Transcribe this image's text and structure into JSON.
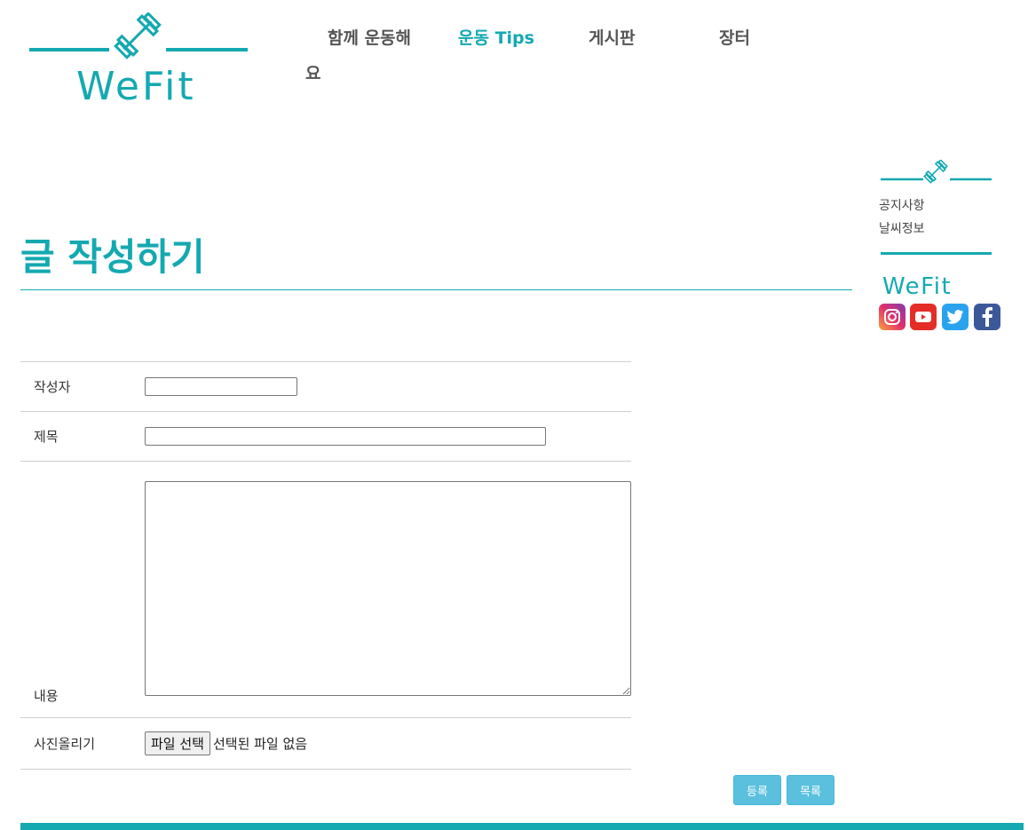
{
  "header": {
    "logo_text": "WeFit",
    "nav": [
      {
        "label": "함께 운동해",
        "wrap": "요",
        "active": false
      },
      {
        "label": "운동 Tips",
        "active": true
      },
      {
        "label": "게시판",
        "active": false
      },
      {
        "label": "장터",
        "active": false
      }
    ]
  },
  "page": {
    "title": "글 작성하기"
  },
  "form": {
    "author_label": "작성자",
    "author_value": "",
    "subject_label": "제목",
    "subject_value": "",
    "content_label": "내용",
    "content_value": "",
    "photo_label": "사진올리기",
    "file_button": "파일 선택",
    "file_status": "선택된 파일 없음"
  },
  "actions": {
    "submit": "등록",
    "list": "목록"
  },
  "sidebar": {
    "links": [
      "공지사항",
      "날씨정보"
    ],
    "logo_text": "WeFit",
    "sns": [
      {
        "name": "instagram-icon",
        "color": "#d6307d"
      },
      {
        "name": "youtube-icon",
        "color": "#e52d27"
      },
      {
        "name": "twitter-icon",
        "color": "#2aa3ef"
      },
      {
        "name": "facebook-icon",
        "color": "#3b5998"
      }
    ]
  },
  "colors": {
    "accent": "#14a9b1",
    "button": "#5bc0de"
  }
}
